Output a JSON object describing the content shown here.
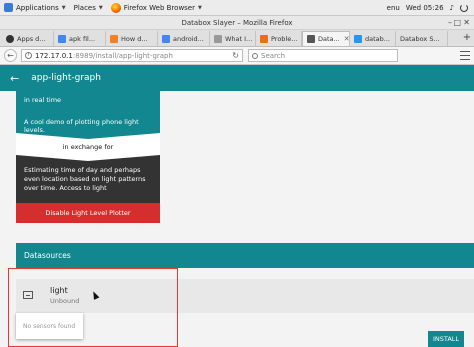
{
  "system_bar": {
    "applications": "Applications",
    "places": "Places",
    "active_app": "Firefox Web Browser",
    "keyboard": "enu",
    "clock": "Wed 05:26"
  },
  "window": {
    "title": "Databox Slayer – Mozilla Firefox"
  },
  "tabs": [
    {
      "label": "Apps d...",
      "color": "#333333"
    },
    {
      "label": "apk fil...",
      "color": "#4285f4"
    },
    {
      "label": "How d...",
      "color": "#f48024"
    },
    {
      "label": "android...",
      "color": "#4285f4"
    },
    {
      "label": "What I...",
      "color": "#999999"
    },
    {
      "label": "Proble...",
      "color": "#e8710a"
    },
    {
      "label": "Data...",
      "color": "#555555"
    },
    {
      "label": "datab...",
      "color": "#2196f3"
    },
    {
      "label": "Databox S...",
      "color": "#777777"
    }
  ],
  "nav": {
    "url_host": "172.17.0.1",
    "url_path": ":8989/install/app-light-graph",
    "search_placeholder": "Search"
  },
  "app": {
    "title": "app-light-graph",
    "card_teal_line1": "in real time",
    "card_teal_line2": "A cool demo of plotting phone light levels.",
    "exchange_label": "in exchange for",
    "dark_text": "Estimating time of day and perhaps even location based on light patterns over time. Access to light",
    "disable_button": "Disable Light Level Plotter",
    "datasources_title": "Datasources",
    "datasource_name": "light",
    "datasource_status": "Unbound",
    "popup_text": "No sensors found",
    "install_button": "INSTALL"
  },
  "colors": {
    "teal": "#12878f",
    "red": "#d32f2f",
    "dark": "#333333",
    "highlight": "#e53935"
  }
}
